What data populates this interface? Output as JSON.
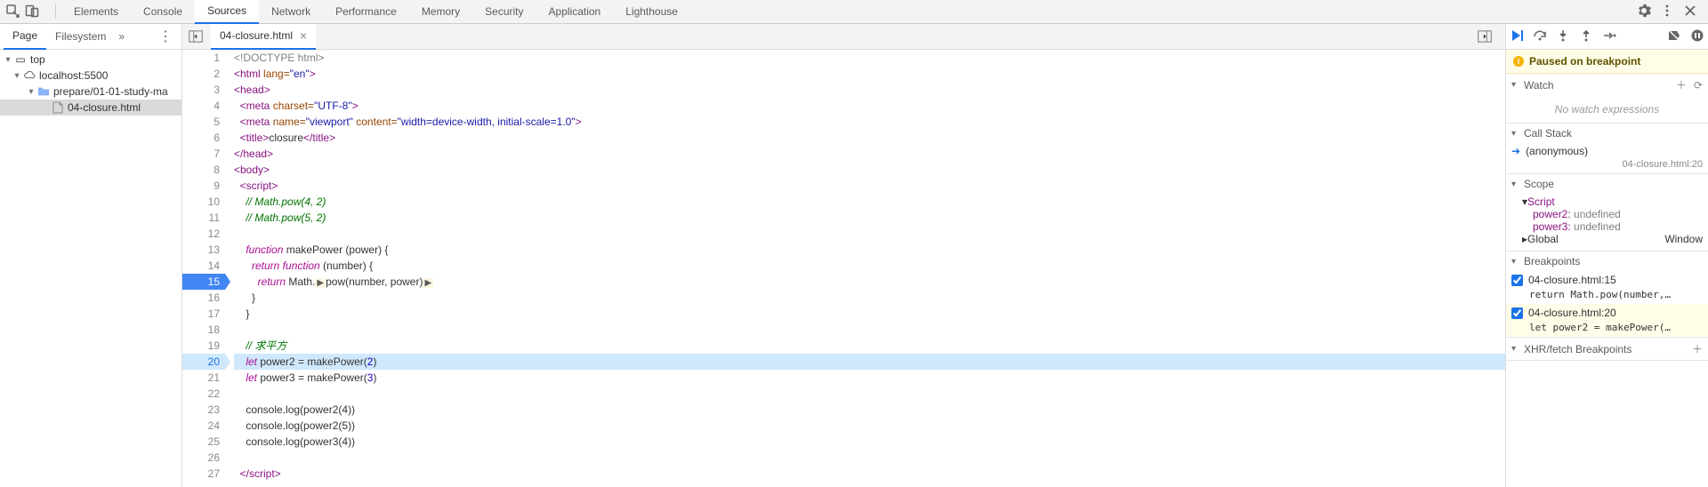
{
  "mainTabs": {
    "items": [
      "Elements",
      "Console",
      "Sources",
      "Network",
      "Performance",
      "Memory",
      "Security",
      "Application",
      "Lighthouse"
    ],
    "active": "Sources"
  },
  "navigator": {
    "tabs": {
      "items": [
        "Page",
        "Filesystem"
      ],
      "active": "Page"
    },
    "tree": {
      "top": "top",
      "origin": "localhost:5500",
      "folder": "prepare/01-01-study-ma",
      "file": "04-closure.html"
    }
  },
  "editor": {
    "tab": {
      "name": "04-closure.html"
    },
    "code": {
      "l1": "<!DOCTYPE html>",
      "l2_open": "<html",
      "l2_attr": " lang=",
      "l2_val": "\"en\"",
      "l2_close": ">",
      "l3": "<head>",
      "l4_open": "  <meta",
      "l4_attr1": " charset=",
      "l4_val1": "\"UTF-8\"",
      "l4_close": ">",
      "l5_open": "  <meta",
      "l5_attr1": " name=",
      "l5_val1": "\"viewport\"",
      "l5_attr2": " content=",
      "l5_val2": "\"width=device-width, initial-scale=1.0\"",
      "l5_close": ">",
      "l6_open": "  <title>",
      "l6_txt": "closure",
      "l6_close": "</title>",
      "l7": "</head>",
      "l8": "<body>",
      "l9": "  <script>",
      "l10": "    // Math.pow(4, 2)",
      "l11": "    // Math.pow(5, 2)",
      "l12": "",
      "l13_kw": "    function",
      "l13_fn": " makePower ",
      "l13_rest": "(power) {",
      "l14_kw": "      return function",
      "l14_rest": " (number) {",
      "l15_kw": "        return",
      "l15_rest": " Math.",
      "l15_call": "pow(number, power)",
      "l16": "      }",
      "l17": "    }",
      "l18": "",
      "l19": "    // 求平方",
      "l20_kw": "    let",
      "l20_var": " power2 ",
      "l20_eq": "= ",
      "l20_fn": "makePower(",
      "l20_num": "2",
      "l20_cp": ")",
      "l21_kw": "    let",
      "l21_var": " power3 ",
      "l21_eq": "= makePower(",
      "l21_num": "3",
      "l21_cp": ")",
      "l22": "",
      "l23": "    console.log(power2(4))",
      "l24": "    console.log(power2(5))",
      "l25": "    console.log(power3(4))",
      "l26": "",
      "l27": "  </script>"
    },
    "execLine": 20,
    "bpLines": [
      15
    ]
  },
  "debugger": {
    "pausedMsg": "Paused on breakpoint",
    "sections": {
      "watch": {
        "title": "Watch",
        "empty": "No watch expressions"
      },
      "callstack": {
        "title": "Call Stack",
        "frame": "(anonymous)",
        "location": "04-closure.html:20"
      },
      "scope": {
        "title": "Scope",
        "script": "Script",
        "vars": [
          {
            "name": "power2:",
            "val": " undefined"
          },
          {
            "name": "power3:",
            "val": " undefined"
          }
        ],
        "global": "Global",
        "globalVal": "Window"
      },
      "breakpoints": {
        "title": "Breakpoints",
        "items": [
          {
            "label": "04-closure.html:15",
            "code": "return Math.pow(number,…",
            "current": false
          },
          {
            "label": "04-closure.html:20",
            "code": "let power2 = makePower(…",
            "current": true
          }
        ]
      },
      "xhr": {
        "title": "XHR/fetch Breakpoints"
      }
    }
  }
}
